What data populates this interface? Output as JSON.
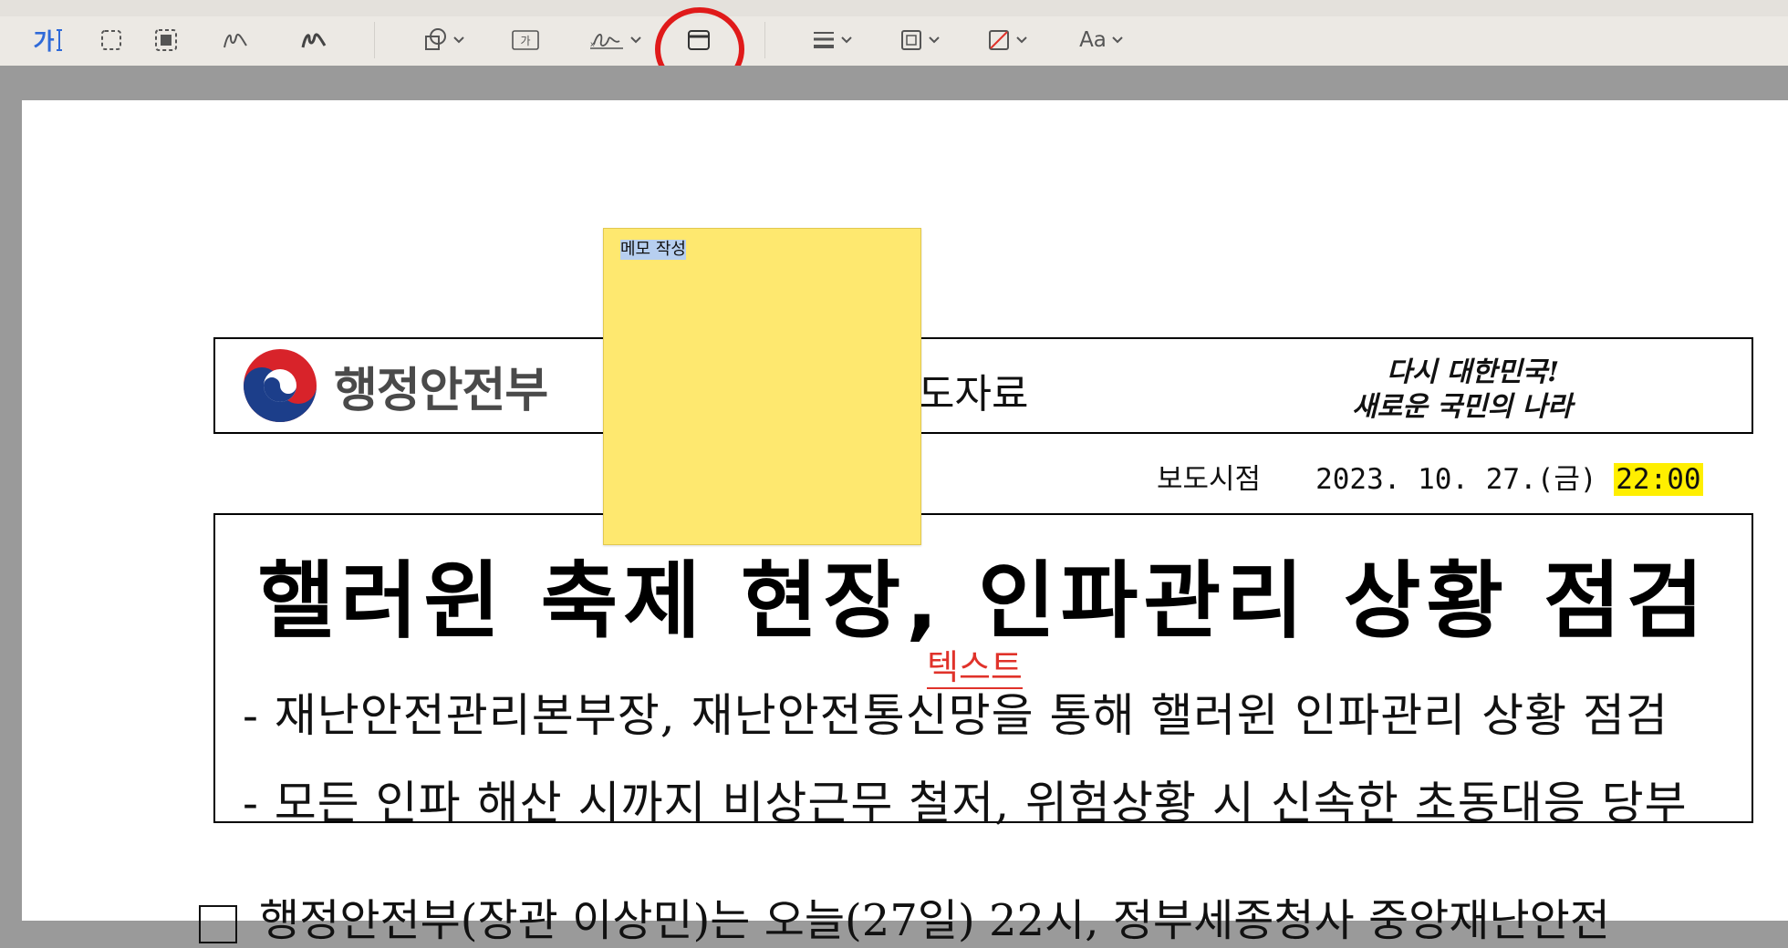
{
  "toolbar": {
    "text_tool_label": "가",
    "aa_label": "Aa",
    "tools": [
      "text-selection-icon",
      "rect-select-icon",
      "smart-lasso-icon",
      "sketch-icon",
      "draw-icon",
      "shapes-icon",
      "text-box-icon",
      "signature-icon",
      "note-icon",
      "line-style-icon",
      "border-color-icon",
      "fill-color-icon",
      "font-icon"
    ]
  },
  "colors": {
    "highlight_ring": "#e01a1a",
    "note_bg": "#fee86f",
    "text_annotation": "#e0322a",
    "time_highlight": "#ffef00"
  },
  "document": {
    "ministry": "행정안전부",
    "release_label": "도자료",
    "slogan_line1": "다시 대한민국!",
    "slogan_line2": "새로운 국민의 나라",
    "date_label": "보도시점",
    "date_value": "2023. 10. 27.(금)",
    "time_value": "22:00",
    "title": "핼러윈 축제 현장, 인파관리 상황 점검",
    "subtitle1": "- 재난안전관리본부장, 재난안전통신망을 통해 핼러윈 인파관리 상황 점검",
    "subtitle2": "- 모든 인파 해산 시까지 비상근무 철저, 위험상황 시 신속한 초동대응 당부",
    "text_annotation": "텍스트",
    "bottom_line": "행정안전부(장관 이상민)는 오늘(27일) 22시, 정부세종청사 중앙재난안전"
  },
  "note": {
    "text": "메모 작성"
  }
}
